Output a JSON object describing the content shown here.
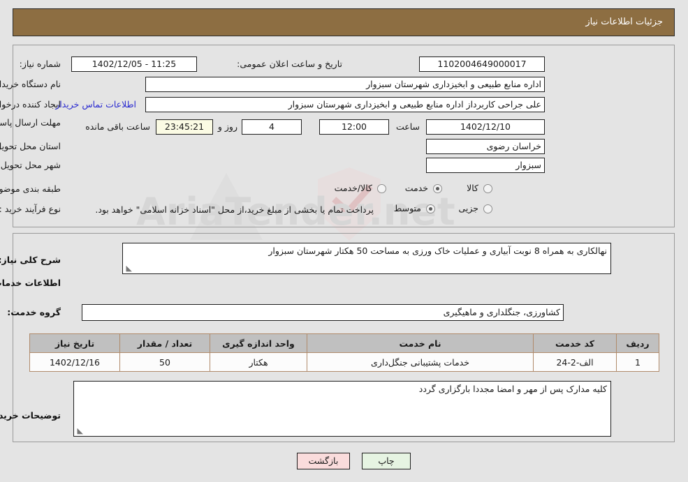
{
  "header": {
    "title": "جزئیات اطلاعات نیاز"
  },
  "form": {
    "need_number": {
      "label": "شماره نیاز:",
      "value": "1102004649000017"
    },
    "announce_datetime": {
      "label": "تاریخ و ساعت اعلان عمومی:",
      "value": "11:25 - 1402/12/05"
    },
    "buyer_org": {
      "label": "نام دستگاه خریدار:",
      "value": "اداره منابع طبیعی و ابخیزداری شهرستان سبزوار"
    },
    "requester": {
      "label": "ایجاد کننده درخواست:",
      "value": "علی جراحی کاربرداز اداره منابع طبیعی و ابخیزداری شهرستان سبزوار"
    },
    "contact_link": "اطلاعات تماس خریدار",
    "deadline": {
      "label": "مهلت ارسال پاسخ: تا تاریخ:",
      "date": "1402/12/10",
      "time_label": "ساعت",
      "time": "12:00",
      "days": "4",
      "days_suffix": "روز و",
      "countdown": "23:45:21",
      "countdown_suffix": "ساعت باقی مانده"
    },
    "province": {
      "label": "استان محل تحویل:",
      "value": "خراسان رضوی"
    },
    "city": {
      "label": "شهر محل تحویل:",
      "value": "سبزوار"
    },
    "category": {
      "label": "طبقه بندی موضوعی:",
      "options": [
        "کالا",
        "خدمت",
        "کالا/خدمت"
      ],
      "selected": "خدمت"
    },
    "purchase_process": {
      "label": "نوع فرآیند خرید :",
      "options": [
        "جزیی",
        "متوسط"
      ],
      "selected": "متوسط"
    },
    "payment_note": "پرداخت تمام یا بخشی از مبلغ خرید،از محل \"اسناد خزانه اسلامی\" خواهد بود."
  },
  "summary": {
    "label": "شرح کلی نیاز:",
    "value": "نهالکاری به همراه 8 نوبت آبیاری و عملیات خاک ورزی به مساحت 50 هکتار شهرستان سبزوار"
  },
  "services_section": {
    "heading": "اطلاعات خدمات مورد نیاز",
    "service_group": {
      "label": "گروه خدمت:",
      "value": "کشاورزی، جنگلداری و ماهیگیری"
    },
    "table": {
      "columns": [
        "ردیف",
        "کد خدمت",
        "نام خدمت",
        "واحد اندازه گیری",
        "تعداد / مقدار",
        "تاریخ نیاز"
      ],
      "rows": [
        {
          "row": "1",
          "code": "الف-2-24",
          "name": "خدمات پشتیبانی جنگل‌داری",
          "unit": "هکتار",
          "quantity": "50",
          "need_date": "1402/12/16"
        }
      ]
    }
  },
  "buyer_notes": {
    "label": "توضیحات خریدار:",
    "value": "کلیه مدارک پس از مهر و امضا مجددا بارگزاری گردد"
  },
  "footer": {
    "print_label": "چاپ",
    "back_label": "بازگشت"
  },
  "watermark": {
    "text": "AriaTender.net"
  },
  "colors": {
    "header_brown": "#8d6e42",
    "table_header_gray": "#c0c0c0",
    "link_blue": "#2a2ad0",
    "countdown_bg": "#fbfbe4",
    "print_bg": "#e6f4e2",
    "back_bg": "#fadcdc"
  }
}
